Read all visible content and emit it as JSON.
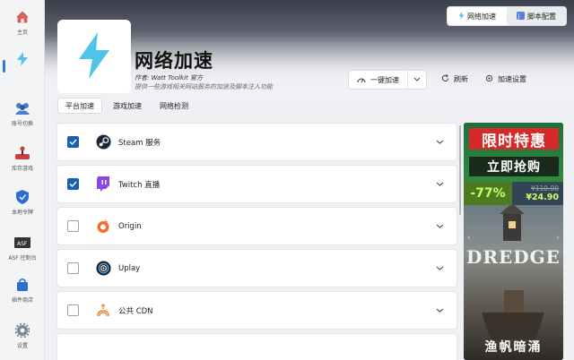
{
  "sidebar": {
    "items": [
      {
        "label": "主页",
        "icon": "home-icon"
      },
      {
        "label": "",
        "icon": "lightning-icon"
      },
      {
        "label": "账号切换",
        "icon": "users-icon"
      },
      {
        "label": "库存游戏",
        "icon": "joystick-icon"
      },
      {
        "label": "本地令牌",
        "icon": "shield-icon"
      },
      {
        "label": "ASF 控制台",
        "icon": "asf-icon"
      },
      {
        "label": "插件商店",
        "icon": "shopping-bag-icon"
      },
      {
        "label": "设置",
        "icon": "gear-icon"
      }
    ]
  },
  "header": {
    "title": "网络加速",
    "author": "作者:  Watt Toolkit  官方",
    "description": "提供一些游戏相关网站服务的加速及脚本注入功能"
  },
  "mode_switch": {
    "accelerate": "网络加速",
    "script": "脚本配置"
  },
  "actions": {
    "one_click": "一键加速",
    "refresh": "刷新",
    "settings": "加速设置"
  },
  "tabs": [
    "平台加速",
    "游戏加速",
    "网络检测"
  ],
  "services": [
    {
      "name": "Steam 服务",
      "checked": true,
      "icon": "steam-icon"
    },
    {
      "name": "Twitch 直播",
      "checked": true,
      "icon": "twitch-icon"
    },
    {
      "name": "Origin",
      "checked": false,
      "icon": "origin-icon"
    },
    {
      "name": "Uplay",
      "checked": false,
      "icon": "uplay-icon"
    },
    {
      "name": "公共 CDN",
      "checked": false,
      "icon": "cdn-icon"
    }
  ],
  "ad": {
    "line1": "限时特惠",
    "line2": "立即抢购",
    "discount": "-77%",
    "old_price": "¥110.00",
    "new_price": "¥24.90",
    "game": "DREDGE",
    "subtitle": "渔帆暗涌"
  },
  "colors": {
    "accent": "#1a5fb4",
    "lightning": "#4fc3e8"
  }
}
